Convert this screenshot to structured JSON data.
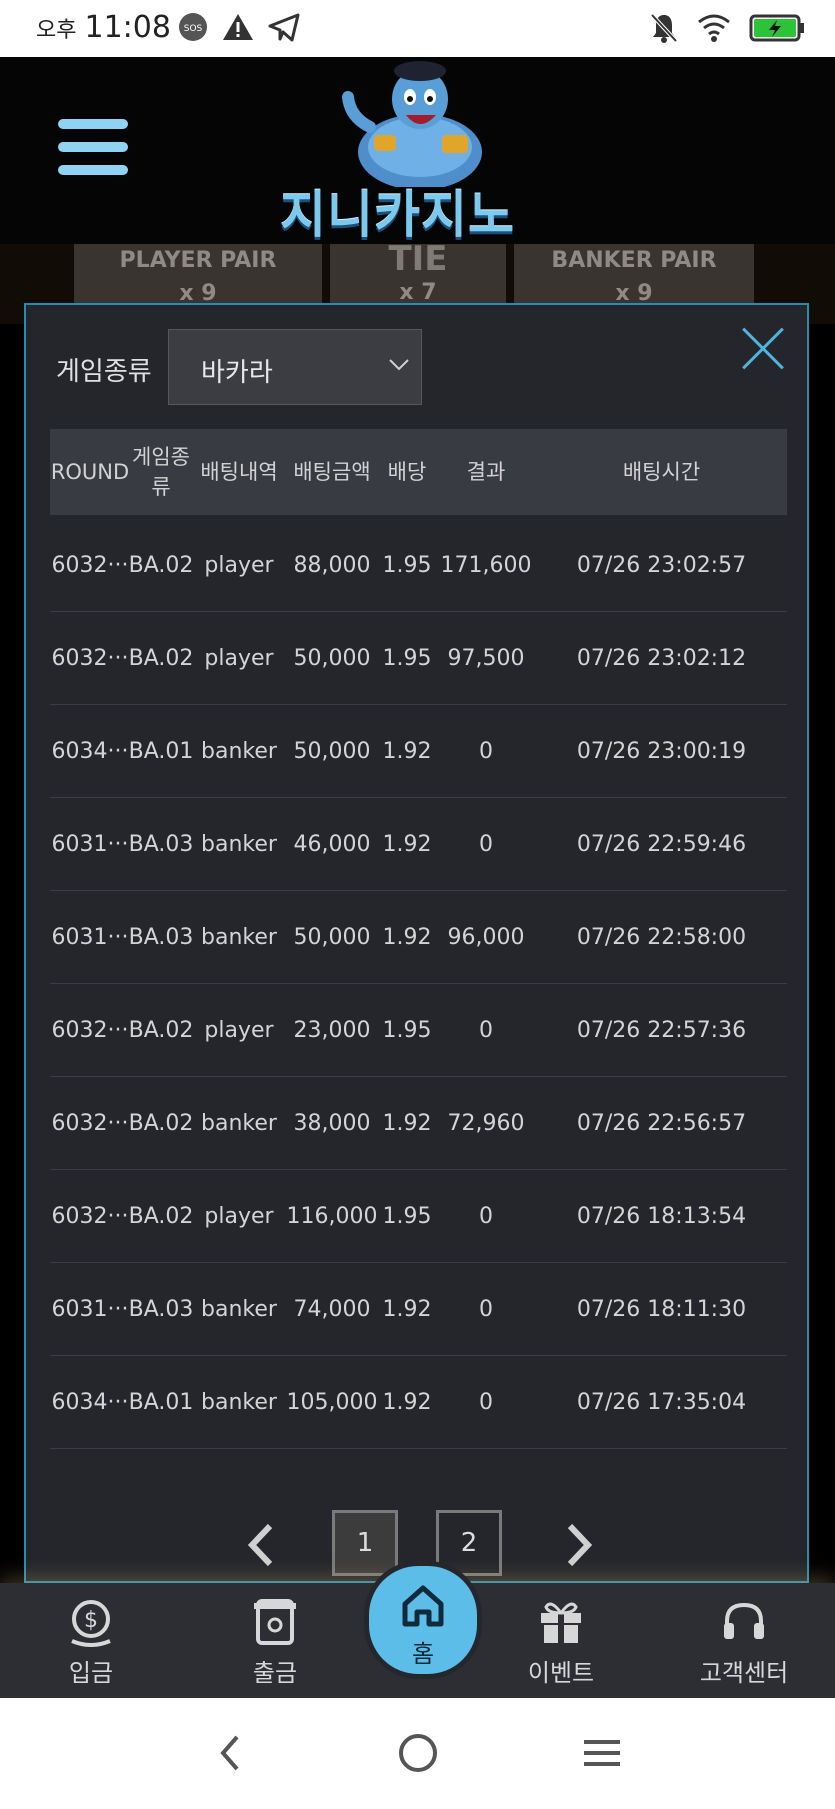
{
  "status_bar": {
    "ampm": "오후",
    "time": "11:08",
    "sos": "SOS"
  },
  "header": {
    "logo_text": "지니카지노"
  },
  "background_table": {
    "player_pair": "PLAYER PAIR",
    "player_pair_mult": "x 9",
    "tie": "TIE",
    "tie_mult": "x 7",
    "banker_pair": "BANKER PAIR",
    "banker_pair_mult": "x 9"
  },
  "modal": {
    "filter_label": "게임종류",
    "select_value": "바카라",
    "columns": [
      "ROUND",
      "게임종류",
      "배팅내역",
      "배팅금액",
      "배당",
      "결과",
      "배팅시간"
    ],
    "rows": [
      [
        "6032···",
        "BA.02",
        "player",
        "88,000",
        "1.95",
        "171,600",
        "07/26 23:02:57"
      ],
      [
        "6032···",
        "BA.02",
        "player",
        "50,000",
        "1.95",
        "97,500",
        "07/26 23:02:12"
      ],
      [
        "6034···",
        "BA.01",
        "banker",
        "50,000",
        "1.92",
        "0",
        "07/26 23:00:19"
      ],
      [
        "6031···",
        "BA.03",
        "banker",
        "46,000",
        "1.92",
        "0",
        "07/26 22:59:46"
      ],
      [
        "6031···",
        "BA.03",
        "banker",
        "50,000",
        "1.92",
        "96,000",
        "07/26 22:58:00"
      ],
      [
        "6032···",
        "BA.02",
        "player",
        "23,000",
        "1.95",
        "0",
        "07/26 22:57:36"
      ],
      [
        "6032···",
        "BA.02",
        "banker",
        "38,000",
        "1.92",
        "72,960",
        "07/26 22:56:57"
      ],
      [
        "6032···",
        "BA.02",
        "player",
        "116,000",
        "1.95",
        "0",
        "07/26 18:13:54"
      ],
      [
        "6031···",
        "BA.03",
        "banker",
        "74,000",
        "1.92",
        "0",
        "07/26 18:11:30"
      ],
      [
        "6034···",
        "BA.01",
        "banker",
        "105,000",
        "1.92",
        "0",
        "07/26 17:35:04"
      ]
    ],
    "pagination": {
      "pages": [
        "1",
        "2"
      ],
      "current": "1"
    }
  },
  "bottom_nav": {
    "deposit": "입금",
    "withdraw": "출금",
    "home": "홈",
    "event": "이벤트",
    "support": "고객센터"
  },
  "colors": {
    "accent": "#5bbde8",
    "modal_border": "#2a8bb0",
    "modal_bg": "#24262b",
    "header_row_bg": "#393b43"
  },
  "icons": [
    "sos-icon",
    "warning-icon",
    "telegram-icon",
    "mute-icon",
    "wifi-icon",
    "battery-icon",
    "menu-icon",
    "close-icon",
    "chevron-down-icon",
    "chevron-left-icon",
    "chevron-right-icon",
    "money-bag-icon",
    "atm-icon",
    "home-icon",
    "gift-icon",
    "headset-icon"
  ]
}
